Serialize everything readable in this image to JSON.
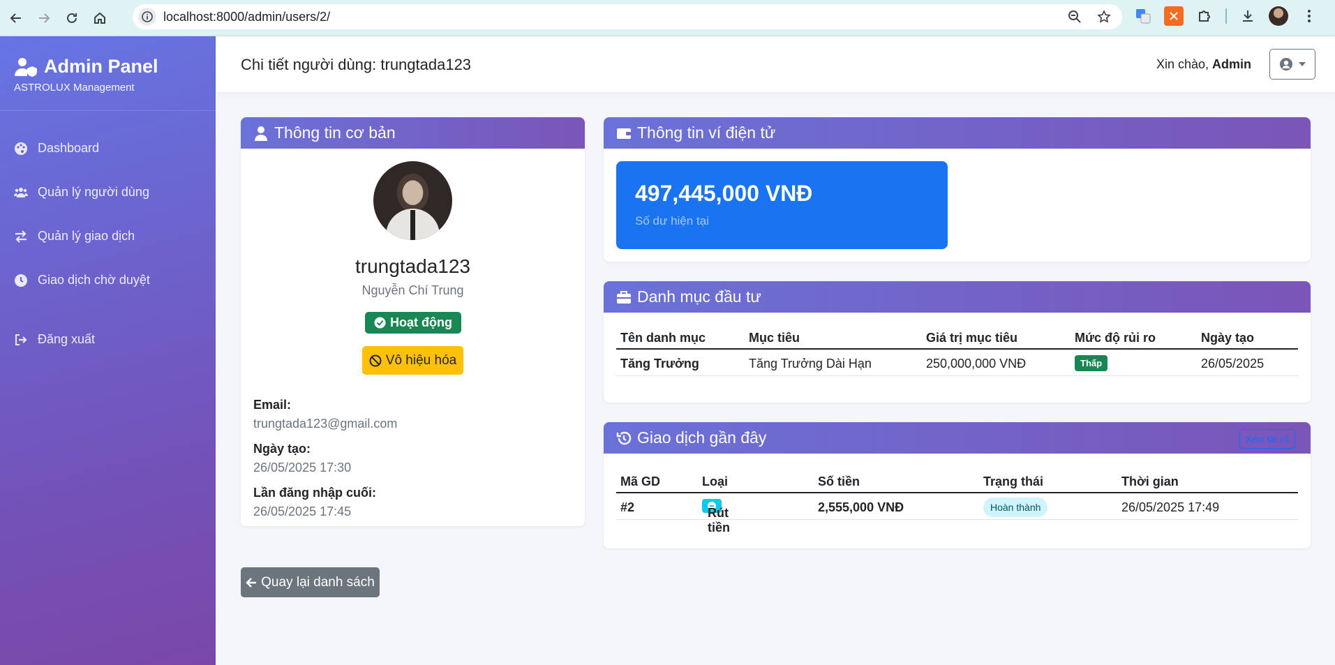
{
  "browser": {
    "url": "localhost:8000/admin/users/2/"
  },
  "sidebar": {
    "brand_title": "Admin Panel",
    "brand_subtitle": "ASTROLUX Management",
    "items": [
      {
        "label": "Dashboard",
        "icon": "palette-icon"
      },
      {
        "label": "Quản lý người dùng",
        "icon": "users-icon"
      },
      {
        "label": "Quản lý giao dịch",
        "icon": "exchange-icon"
      },
      {
        "label": "Giao dịch chờ duyệt",
        "icon": "clock-icon"
      }
    ],
    "logout_label": "Đăng xuất"
  },
  "header": {
    "title": "Chi tiết người dùng: trungtada123",
    "greeting_prefix": "Xin chào, ",
    "greeting_name": "Admin"
  },
  "basic_info": {
    "title": "Thông tin cơ bản",
    "username": "trungtada123",
    "full_name": "Nguyễn Chí Trung",
    "status": "Hoạt động",
    "disable_label": "Vô hiệu hóa",
    "email_label": "Email:",
    "email": "trungtada123@gmail.com",
    "created_label": "Ngày tạo:",
    "created": "26/05/2025 17:30",
    "last_login_label": "Lần đăng nhập cuối:",
    "last_login": "26/05/2025 17:45"
  },
  "wallet": {
    "title": "Thông tin ví điện tử",
    "balance": "497,445,000 VNĐ",
    "balance_label": "Số dư hiện tại"
  },
  "portfolio": {
    "title": "Danh mục đầu tư",
    "columns": [
      "Tên danh mục",
      "Mục tiêu",
      "Giá trị mục tiêu",
      "Mức độ rủi ro",
      "Ngày tạo"
    ],
    "rows": [
      {
        "name": "Tăng Trưởng",
        "goal": "Tăng Trưởng Dài Hạn",
        "target": "250,000,000 VNĐ",
        "risk": "Thấp",
        "created": "26/05/2025"
      }
    ]
  },
  "recent": {
    "title": "Giao dịch gần đây",
    "view_all": "Xem tất cả",
    "columns": [
      "Mã GD",
      "Loại",
      "Số tiền",
      "Trạng thái",
      "Thời gian"
    ],
    "rows": [
      {
        "id": "#2",
        "type": "Rút tiền",
        "amount": "2,555,000 VNĐ",
        "status": "Hoàn thành",
        "time": "26/05/2025 17:49"
      }
    ]
  },
  "back_label": "Quay lại danh sách",
  "colors": {
    "sidebar_start": "#6675e3",
    "sidebar_end": "#7a48a8",
    "success": "#198754",
    "warning": "#ffc107",
    "primary": "#1a73f0",
    "info": "#0dcaf0",
    "secondary": "#6c757d"
  }
}
